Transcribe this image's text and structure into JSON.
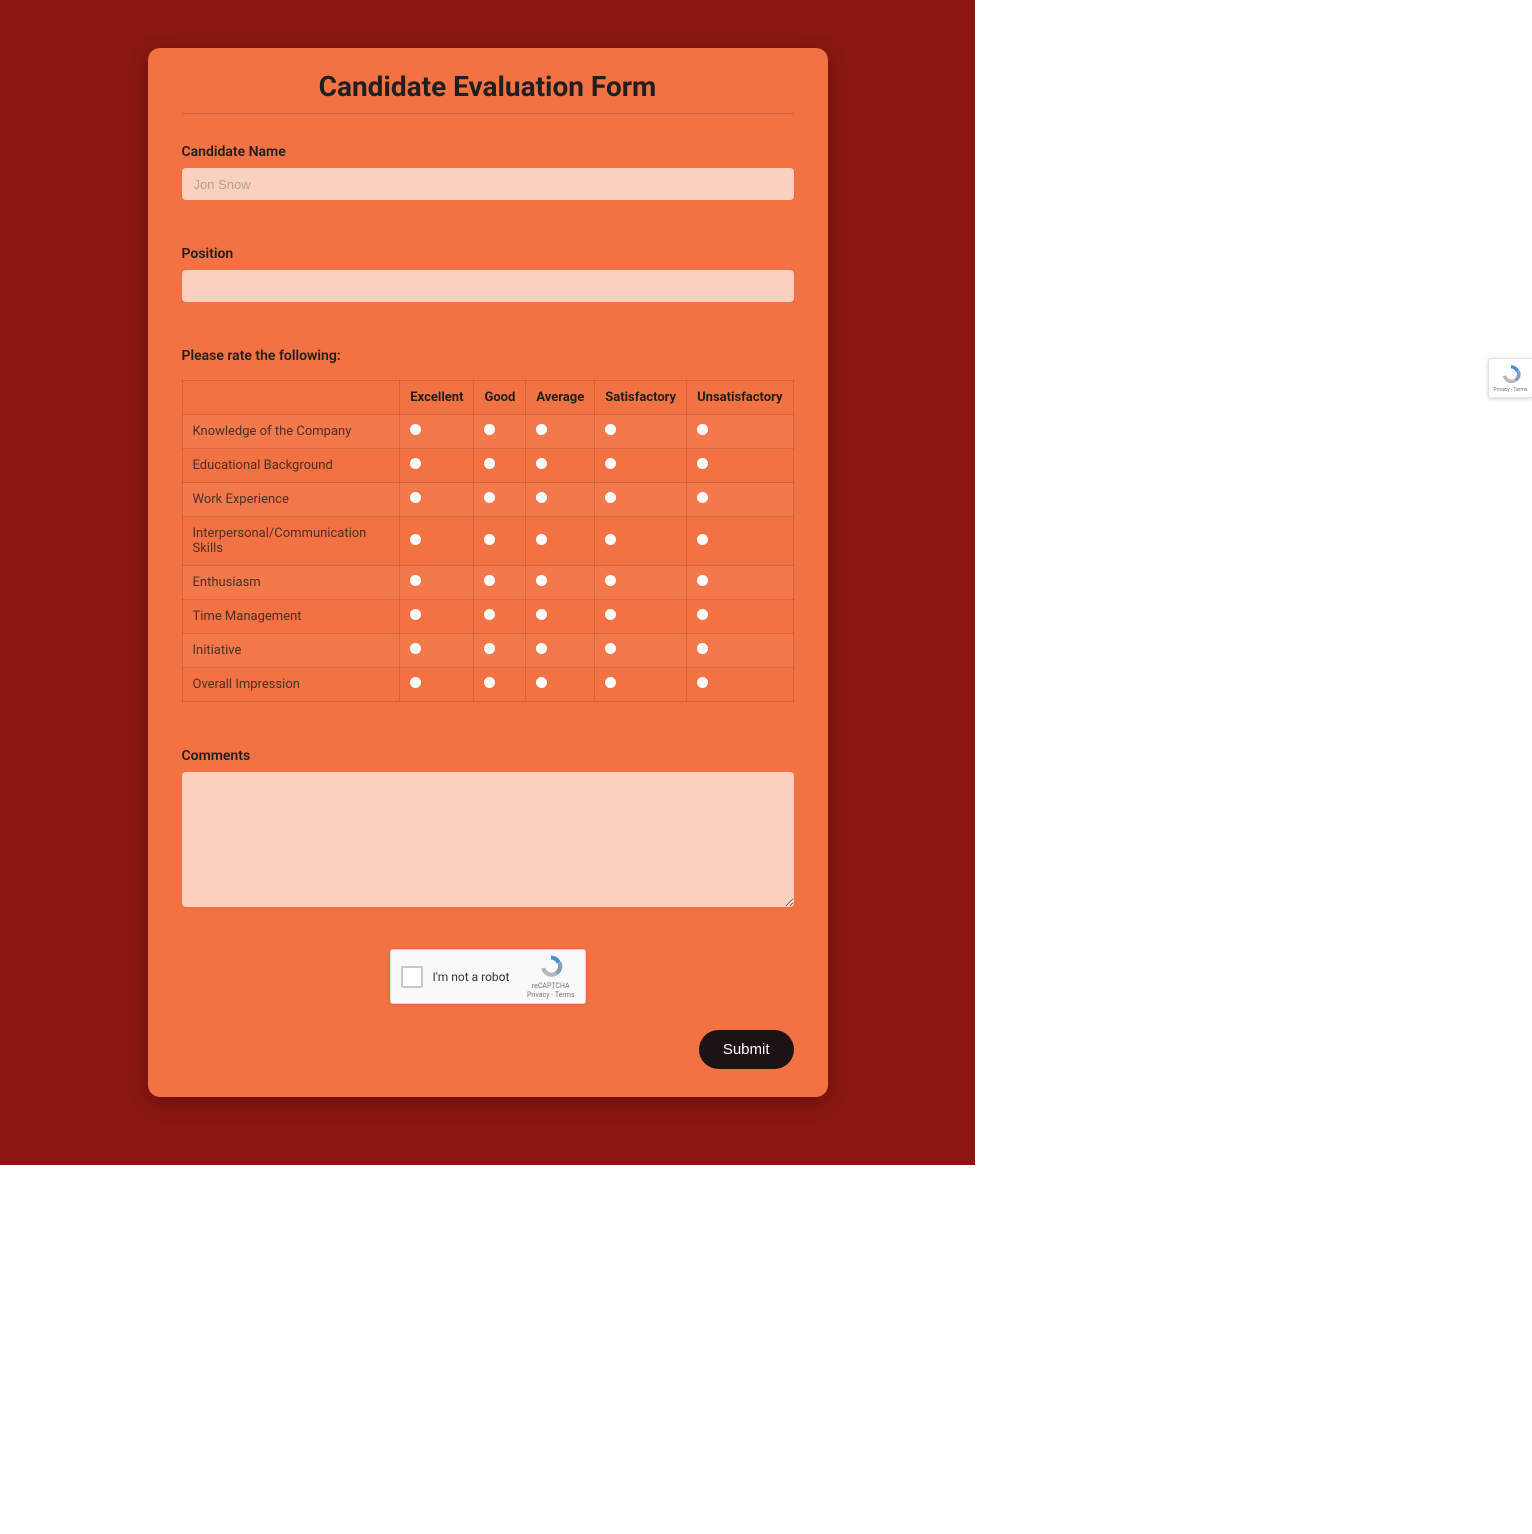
{
  "form": {
    "title": "Candidate Evaluation Form",
    "candidate_name": {
      "label": "Candidate Name",
      "placeholder": "Jon Snow",
      "value": ""
    },
    "position": {
      "label": "Position",
      "placeholder": "",
      "value": ""
    },
    "rating_section_label": "Please rate the following:",
    "rating_columns": [
      "Excellent",
      "Good",
      "Average",
      "Satisfactory",
      "Unsatisfactory"
    ],
    "rating_rows": [
      "Knowledge of the Company",
      "Educational Background",
      "Work Experience",
      "Interpersonal/Communication Skills",
      "Enthusiasm",
      "Time Management",
      "Initiative",
      "Overall Impression"
    ],
    "comments": {
      "label": "Comments",
      "value": ""
    },
    "captcha": {
      "label": "I'm not a robot",
      "brand": "reCAPTCHA",
      "links": "Privacy - Terms"
    },
    "submit_label": "Submit"
  },
  "floating_badge": {
    "links": "Privacy - Terms"
  }
}
